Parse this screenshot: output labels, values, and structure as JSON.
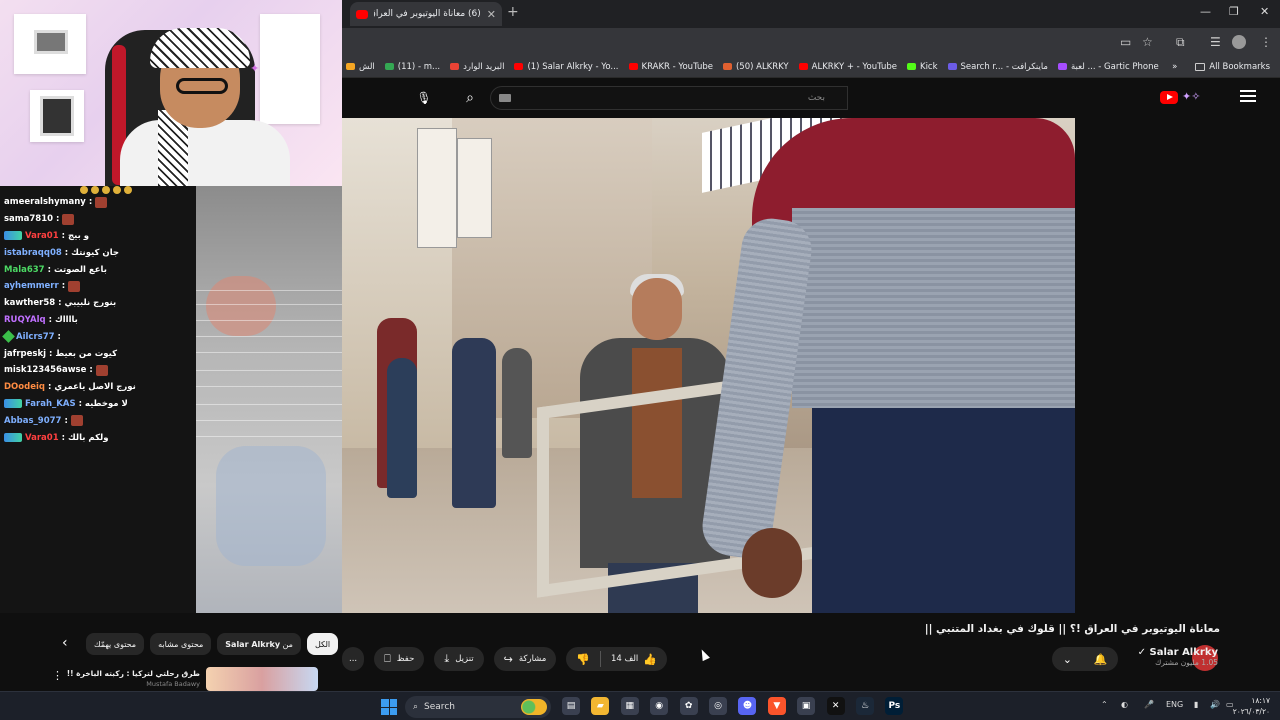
{
  "browser": {
    "tab_title": "(6) معاناة اليوتيوبر في العراق",
    "new_tab": "+",
    "window_controls": [
      "—",
      "❐",
      "✕"
    ]
  },
  "bookmarks": {
    "items": [
      {
        "label": "الش",
        "color": "#f5a623"
      },
      {
        "label": "(11) - m...",
        "color": "#34a853"
      },
      {
        "label": "البريد الوارد",
        "color": "#ea4335"
      },
      {
        "label": "(1) Salar Alkrky - Yo...",
        "color": "#ff0000"
      },
      {
        "label": "KRAKR - YouTube",
        "color": "#ff0000"
      },
      {
        "label": "(50) ALKRKY",
        "color": "#e06030"
      },
      {
        "label": "ALKRKY + - YouTube",
        "color": "#ff0000"
      },
      {
        "label": "Kick",
        "color": "#53fc18"
      },
      {
        "label": "Search r... - ماينكرافت",
        "color": "#6c5ce7"
      },
      {
        "label": "لعبة ... - Gartic Phone",
        "color": "#a64dff"
      }
    ],
    "more": "»",
    "all_bookmarks": "All Bookmarks"
  },
  "youtube": {
    "search_placeholder": "بحث",
    "video_title": "معاناة اليوتيوبر في العراق !؟ || قلوك في بغداد المتنبي ||",
    "channel_name": "Salar Alkrky",
    "subscribers": "1.05 مليون مشترك",
    "likes": "14 الف",
    "share": "مشاركة",
    "download": "تنزيل",
    "save": "حفظ",
    "more": "..."
  },
  "chips": [
    {
      "label": "الكل",
      "active": true
    },
    {
      "label": "من",
      "bold": "Salar Alkrky"
    },
    {
      "label": "محتوى مشابه"
    },
    {
      "label": "محتوى يهمّك"
    }
  ],
  "recommended": {
    "title": "طرق رحلتي لتركيا : ركبته الباخرة !!",
    "channel": "Mustafa Badawy"
  },
  "chat": {
    "messages": [
      {
        "user": "ameeralshymany",
        "color": "#ffffff",
        "text": ":",
        "emote": true
      },
      {
        "user": "sama7810",
        "color": "#ffffff",
        "text": ":",
        "emote": true
      },
      {
        "user": "Vara01",
        "color": "#ff4040",
        "text": ": و بيج",
        "badge": true
      },
      {
        "user": "istabraqq08",
        "color": "#7fb0ff",
        "text": ": جان كيونتك"
      },
      {
        "user": "Mala637",
        "color": "#4cd964",
        "text": ": باعع الصوتت"
      },
      {
        "user": "ayhemmerr",
        "color": "#7fb0ff",
        "text": ":",
        "emote": true
      },
      {
        "user": "kawther58",
        "color": "#ffffff",
        "text": ": بنورج نلبيبي"
      },
      {
        "user": "RUQYAlq",
        "color": "#c070ff",
        "text": ": بااااك"
      },
      {
        "user": "Ailcrs77",
        "color": "#7fb0ff",
        "text": ":",
        "gem": true
      },
      {
        "user": "jafrpeskj",
        "color": "#ffffff",
        "text": ": كيوت من بعيط"
      },
      {
        "user": "misk123456awse",
        "color": "#ffffff",
        "text": ":",
        "emote": true
      },
      {
        "user": "DOodeiq",
        "color": "#ff8c42",
        "text": ": نورج الاصل ياعمري"
      },
      {
        "user": "Farah_KAS",
        "color": "#7fb0ff",
        "text": ": لا موخطيه",
        "badge": true
      },
      {
        "user": "Abbas_9077",
        "color": "#7fb0ff",
        "text": ":",
        "emote": true
      },
      {
        "user": "Vara01",
        "color": "#ff4040",
        "text": ": ولكم بالك",
        "badge": true
      }
    ]
  },
  "taskbar": {
    "search_label": "Search",
    "language": "ENG",
    "time": "١٨:١٧",
    "date": "٢٠٢٦/٠٣/٢٠",
    "apps": [
      {
        "name": "file-icon",
        "label": "▤",
        "bg": "#3a4050"
      },
      {
        "name": "explorer-icon",
        "label": "▰",
        "bg": "#f2b632"
      },
      {
        "name": "store-icon",
        "label": "▦",
        "bg": "#3a4050"
      },
      {
        "name": "chrome-icon",
        "label": "◉",
        "bg": "#3a4050"
      },
      {
        "name": "chatgpt-icon",
        "label": "✿",
        "bg": "#3a4050"
      },
      {
        "name": "obs-icon",
        "label": "◎",
        "bg": "#3a4050"
      },
      {
        "name": "discord-icon",
        "label": "☻",
        "bg": "#5865f2"
      },
      {
        "name": "brave-icon",
        "label": "▼",
        "bg": "#fb542b"
      },
      {
        "name": "network-app-icon",
        "label": "▣",
        "bg": "#3a4050"
      },
      {
        "name": "capcut-icon",
        "label": "✕",
        "bg": "#111111"
      },
      {
        "name": "steam-icon",
        "label": "♨",
        "bg": "#1b2838"
      },
      {
        "name": "photoshop-icon",
        "label": "Ps",
        "bg": "#001e36"
      }
    ]
  }
}
